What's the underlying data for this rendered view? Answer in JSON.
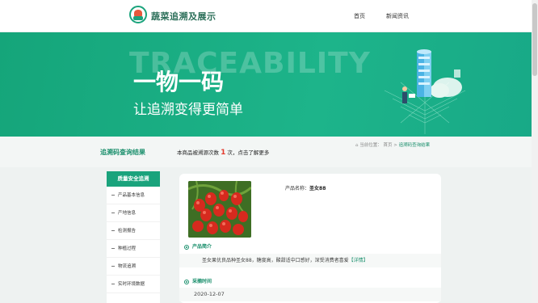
{
  "header": {
    "brand": "蔬菜追溯及展示",
    "nav": [
      {
        "label": "首页"
      },
      {
        "label": "新闻资讯"
      }
    ]
  },
  "banner": {
    "watermark": "TRACEABILITY",
    "headline": "一物一码",
    "subtitle": "让追溯变得更简单"
  },
  "strip": {
    "title": "追溯码查询结果",
    "count_prefix": "本商品被溯源次数",
    "count_value": "1",
    "count_suffix": "次，点击了解更多",
    "breadcrumb": {
      "prefix": "当前位置：",
      "home": "首页",
      "sep": " > ",
      "current": "追溯码查询结果"
    }
  },
  "sidebar": {
    "heading": "质量安全追溯",
    "items": [
      {
        "label": "产品基本信息"
      },
      {
        "label": "产地信息"
      },
      {
        "label": "检测报告"
      },
      {
        "label": "种植过程"
      },
      {
        "label": "物流追溯"
      },
      {
        "label": "实时环境数据"
      }
    ]
  },
  "product": {
    "name_label": "产品名称：",
    "name_value": "圣女88",
    "intro_heading": "产品简介",
    "intro_text": "圣女果优良品种圣女88，糖度高，酸甜适中口感好，深受消费者喜爱",
    "intro_more": "【详情】",
    "harvest_heading": "采摘时间",
    "harvest_date": "2020-12-07"
  },
  "colors": {
    "brand_green": "#1aa37c",
    "accent_red": "#e33b2e"
  }
}
